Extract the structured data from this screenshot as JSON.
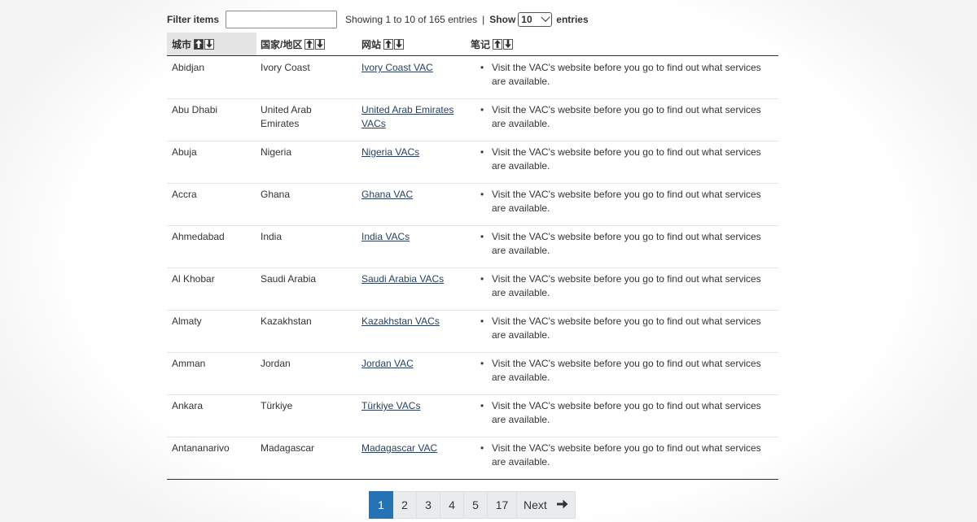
{
  "filter": {
    "label": "Filter items",
    "value": "",
    "placeholder": ""
  },
  "info": {
    "showing": "Showing 1 to 10 of 165 entries",
    "separator": "|",
    "show_label": "Show",
    "show_value": "10",
    "entries_label": "entries"
  },
  "table": {
    "headers": {
      "city": "城市",
      "country": "国家/地区",
      "website": "网站",
      "notes": "笔记"
    },
    "rows": [
      {
        "city": "Abidjan",
        "country": "Ivory Coast",
        "website": "Ivory Coast VAC",
        "note": "Visit the VAC's website before you go to find out what services are available."
      },
      {
        "city": "Abu Dhabi",
        "country": "United Arab Emirates",
        "website": "United Arab Emirates VACs",
        "note": "Visit the VAC's website before you go to find out what services are available."
      },
      {
        "city": "Abuja",
        "country": "Nigeria",
        "website": "Nigeria VACs",
        "note": "Visit the VAC's website before you go to find out what services are available."
      },
      {
        "city": "Accra",
        "country": "Ghana",
        "website": "Ghana VAC",
        "note": "Visit the VAC's website before you go to find out what services are available."
      },
      {
        "city": "Ahmedabad",
        "country": "India",
        "website": "India VACs",
        "note": "Visit the VAC's website before you go to find out what services are available."
      },
      {
        "city": "Al Khobar",
        "country": "Saudi Arabia",
        "website": "Saudi Arabia VACs",
        "note": "Visit the VAC's website before you go to find out what services are available."
      },
      {
        "city": "Almaty",
        "country": "Kazakhstan",
        "website": "Kazakhstan VACs",
        "note": "Visit the VAC's website before you go to find out what services are available."
      },
      {
        "city": "Amman",
        "country": "Jordan",
        "website": "Jordan VAC",
        "note": "Visit the VAC's website before you go to find out what services are available."
      },
      {
        "city": "Ankara",
        "country": "Türkiye",
        "website": "Türkiye VACs",
        "note": "Visit the VAC's website before you go to find out what services are available."
      },
      {
        "city": "Antananarivo",
        "country": "Madagascar",
        "website": "Madagascar VAC",
        "note": "Visit the VAC's website before you go to find out what services are available."
      }
    ]
  },
  "pagination": {
    "pages": [
      "1",
      "2",
      "3",
      "4",
      "5",
      "17"
    ],
    "current": "1",
    "next_label": "Next",
    "next_icon": "arrow-right-icon"
  },
  "colors": {
    "link": "#284162",
    "pager_active": "#2572b4",
    "pager_bg": "#eaebed"
  }
}
